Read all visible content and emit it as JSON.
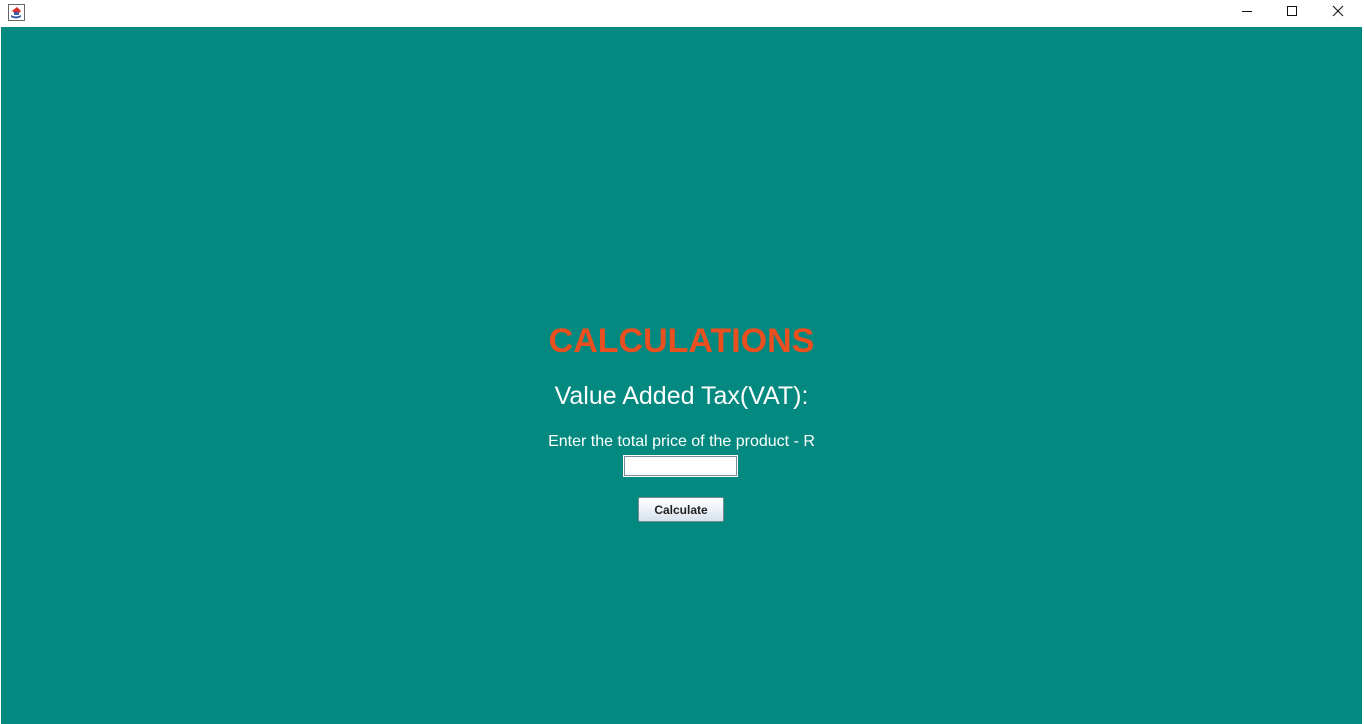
{
  "window": {
    "app_icon": "java-coffee-cup-icon",
    "controls": {
      "minimize_icon": "minimize-icon",
      "maximize_icon": "maximize-icon",
      "close_icon": "close-icon"
    }
  },
  "main": {
    "heading": "CALCULATIONS",
    "subheading": "Value Added Tax(VAT):",
    "prompt": "Enter the total price of the product - R",
    "price_input": {
      "value": "",
      "placeholder": ""
    },
    "calculate_label": "Calculate"
  },
  "colors": {
    "background": "#038980",
    "heading": "#ea4f1f",
    "text": "#ffffff"
  }
}
